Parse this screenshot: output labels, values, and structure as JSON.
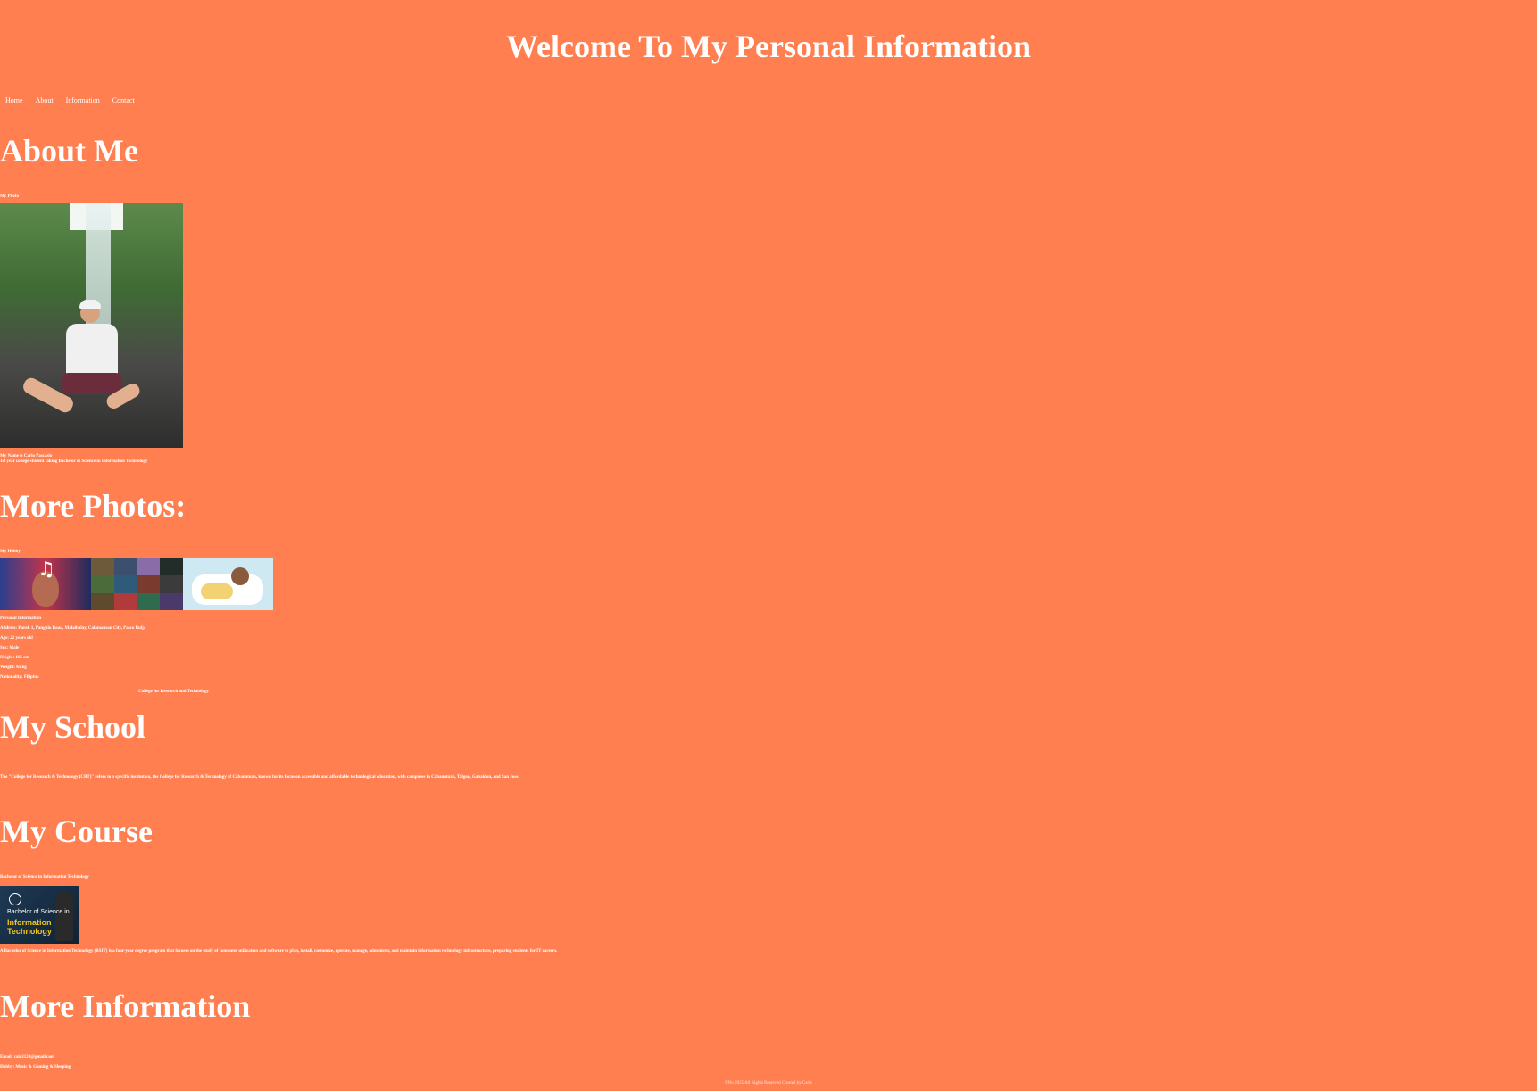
{
  "header": {
    "title": "Welcome To My Personal Information"
  },
  "nav": {
    "items": [
      "Home",
      "About",
      "Information",
      "Contact"
    ]
  },
  "about": {
    "heading": "About Me",
    "photo_caption": "My Photo",
    "name_line": "My Name is Carlo Pascasio",
    "desc_line": "1st year college student taking Bachelor of Science in Information Technology"
  },
  "photos": {
    "heading": "More Photos:",
    "hobby_caption": "My Hobby"
  },
  "personal": {
    "title": "Personal Information",
    "fields": [
      {
        "label": "Address:",
        "value": "Purok 1, Pangulo Road, Malaibalay, Calamansan City, Pasco Bulja"
      },
      {
        "label": "Age:",
        "value": "22 years old"
      },
      {
        "label": "Sex:",
        "value": "Male"
      },
      {
        "label": "Height:",
        "value": "165 cm"
      },
      {
        "label": "Weight:",
        "value": "65 kg"
      },
      {
        "label": "Nationality:",
        "value": "Filipino"
      }
    ],
    "school_name": "College for Research and Technology"
  },
  "school": {
    "heading": "My School",
    "text": "The \"College for Research & Technology (CRT)\" refers to a specific institution, the College for Research & Technology of Cabanatuan, known for its focus on accessible and affordable technological education, with campuses in Cabanatuan, Talgon, Gabaldon, and San Jose."
  },
  "course": {
    "heading": "My Course",
    "caption": "Bachelor of Science in Information Technology",
    "image_line1": "Bachelor of Science in",
    "image_line2": "Information",
    "image_line3": "Technology",
    "image_logo": "CRT",
    "text": "A Bachelor of Science in Information Technology (BSIT) is a four-year degree program that focuses on the study of computer utilization and software to plan, install, customize, operate, manage, administer, and maintain information technology infrastructure, preparing students for IT careers."
  },
  "more_info": {
    "heading": "More Information",
    "fields": [
      {
        "label": "Email:",
        "value": "calo3120@gmail.com"
      },
      {
        "label": "Hobby:",
        "value": "Music & Gaming & Sleeping"
      }
    ]
  },
  "footer": {
    "text": "©No 2025 All Rights Reserved Created by Carlo"
  },
  "colors": {
    "background": "#ff7f50",
    "text": "#ffffff"
  }
}
